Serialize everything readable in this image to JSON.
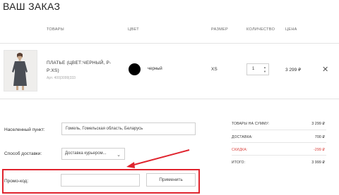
{
  "page": {
    "title": "ВАШ ЗАКАЗ"
  },
  "table": {
    "headers": {
      "goods": "ТОВАРЫ",
      "color": "ЦВЕТ",
      "size": "РАЗМЕР",
      "quantity": "КОЛИЧЕСТВО",
      "price": "ЦЕНА"
    }
  },
  "item": {
    "name": "ПЛАТЬЕ (ЦВЕТ:ЧЕРНЫЙ, Р-Р:XS)",
    "article": "Арт. 400|3099|333",
    "color_name": "черный",
    "color_hex": "#000000",
    "size": "XS",
    "quantity": "1",
    "price": "3 299 ₽",
    "remove_icon": "close-icon"
  },
  "form": {
    "city_label": "Населенный пункт:",
    "city_value": "Гомель, Гомельская область, Беларусь",
    "delivery_label": "Способ доставки:",
    "delivery_value": "Доставка курьером...",
    "promo_label": "Промо-код:",
    "promo_value": "",
    "apply_button": "Применить"
  },
  "summary": {
    "goods_total_label": "ТОВАРЫ НА СУММУ:",
    "goods_total_value": "3 299 ₽",
    "delivery_label": "ДОСТАВКА:",
    "delivery_value": "700 ₽",
    "discount_label": "СКИДКА:",
    "discount_value": "-299 ₽",
    "total_label": "ИТОГО:",
    "total_value": "3 999 ₽"
  },
  "annotation": {
    "highlight_color": "#e0242e",
    "arrow_color": "#e0242e"
  }
}
